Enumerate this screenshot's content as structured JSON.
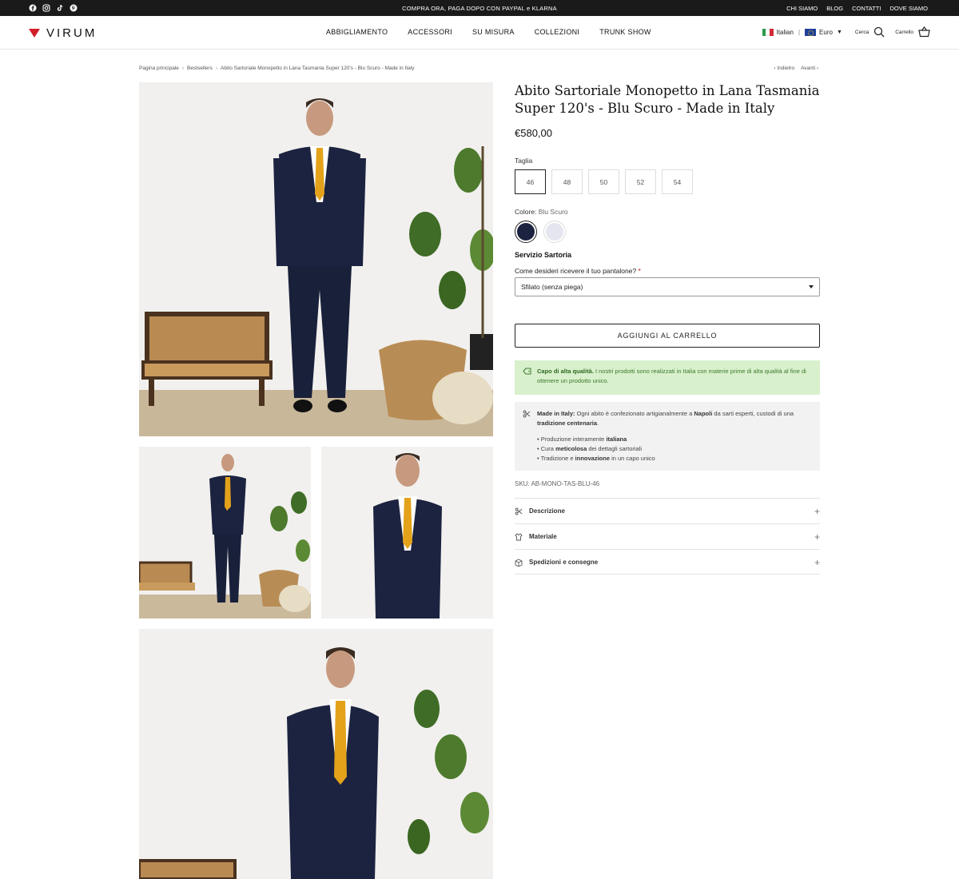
{
  "topbar": {
    "socials": [
      "facebook-icon",
      "instagram-icon",
      "tiktok-icon",
      "pinterest-icon"
    ],
    "promo": "COMPRA ORA, PAGA DOPO CON PAYPAL e KLARNA",
    "links": [
      "CHI SIAMO",
      "BLOG",
      "CONTATTI",
      "DOVE SIAMO"
    ]
  },
  "header": {
    "logo": "VIRUM",
    "nav": [
      "ABBIGLIAMENTO",
      "ACCESSORI",
      "SU MISURA",
      "COLLEZIONI",
      "TRUNK SHOW"
    ],
    "language": "Italian",
    "currency": "Euro",
    "search_label": "Cerca",
    "cart_label": "Carrello"
  },
  "breadcrumb": {
    "items": [
      "Pagina principale",
      "Bestsellers",
      "Abito Sartoriale Monopetto in Lana Tasmania Super 120's - Blu Scuro - Made in Italy"
    ],
    "prev": "Indietro",
    "next": "Avanti"
  },
  "product": {
    "title": "Abito Sartoriale Monopetto in Lana Tasmania Super 120's - Blu Scuro - Made in Italy",
    "price": "€580,00",
    "size_label": "Taglia",
    "sizes": [
      "46",
      "48",
      "50",
      "52",
      "54"
    ],
    "selected_size": "46",
    "color_label": "Colore:",
    "color_value": "Blu Scuro",
    "swatch_colors": [
      "#1c2340",
      "#e4e5ee"
    ],
    "servizio": "Servizio Sartoria",
    "question": "Come desideri ricevere il tuo pantalone?",
    "required_mark": "*",
    "select_value": "Sfilato (senza piega)",
    "cart_button": "AGGIUNGI AL CARRELLO",
    "quality_bold": "Capo di alta qualità.",
    "quality_text": "I nostri prodotti sono realizzati in Italia con materie prime di alta qualità al fine di ottenere un prodotto unico.",
    "made_bold": "Made in Italy:",
    "made_text_1": "Ogni abito è confezionato artigianalmente a",
    "made_city": "Napoli",
    "made_text_2": "da sarti esperti, custodi di una",
    "made_trad": "tradizione centenaria",
    "made_end": ".",
    "bullets": [
      {
        "pre": "Produzione interamente ",
        "bold": "italiana",
        "post": ""
      },
      {
        "pre": "Cura ",
        "bold": "meticolosa",
        "post": " dei dettagli sartoriali"
      },
      {
        "pre": "Tradizione e ",
        "bold": "innovazione",
        "post": " in un capo unico"
      }
    ],
    "sku": "SKU: AB-MONO-TAS-BLU-46",
    "accordions": [
      "Descrizione",
      "Materiale",
      "Spedizioni e consegne"
    ]
  },
  "colors": {
    "suit": "#1c2340",
    "tie": "#e3a21a",
    "accent_red": "#d01e2a",
    "quality_bg": "#d9f0cd"
  }
}
